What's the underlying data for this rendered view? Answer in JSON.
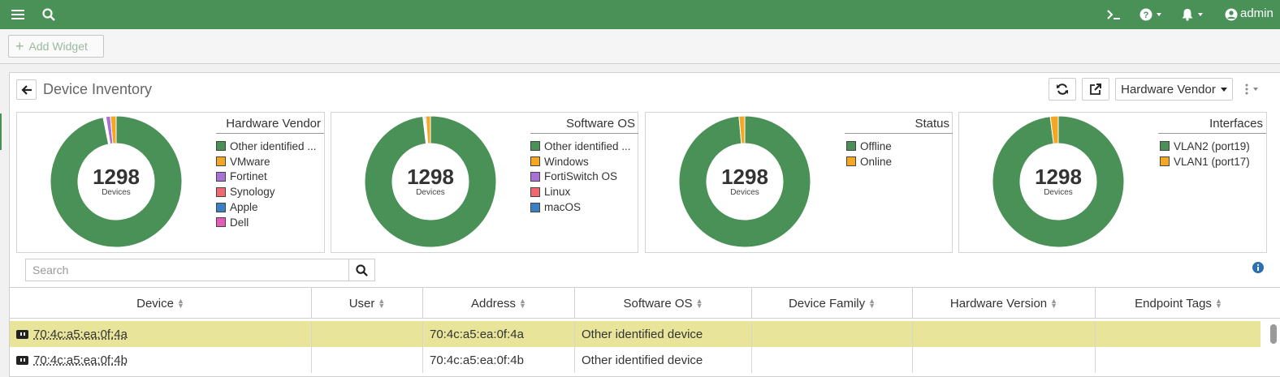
{
  "header": {
    "user": "admin",
    "icons": [
      "menu-icon",
      "search-icon",
      "terminal-icon",
      "help-icon",
      "bell-icon",
      "user-icon"
    ]
  },
  "toolbar": {
    "add_widget_label": "Add Widget"
  },
  "widget": {
    "title": "Device Inventory",
    "dropdown_label": "Hardware Vendor"
  },
  "donuts": [
    {
      "title": "Hardware Vendor",
      "total": "1298",
      "sub": "Devices",
      "legend": [
        {
          "label": "Other identified ...",
          "color": "#4a9158"
        },
        {
          "label": "VMware",
          "color": "#f5a623"
        },
        {
          "label": "Fortinet",
          "color": "#a970d6"
        },
        {
          "label": "Synology",
          "color": "#f0676f"
        },
        {
          "label": "Apple",
          "color": "#3a7fc4"
        },
        {
          "label": "Dell",
          "color": "#e65bb8"
        }
      ]
    },
    {
      "title": "Software OS",
      "total": "1298",
      "sub": "Devices",
      "legend": [
        {
          "label": "Other identified ...",
          "color": "#4a9158"
        },
        {
          "label": "Windows",
          "color": "#f5a623"
        },
        {
          "label": "FortiSwitch OS",
          "color": "#a970d6"
        },
        {
          "label": "Linux",
          "color": "#f0676f"
        },
        {
          "label": "macOS",
          "color": "#3a7fc4"
        }
      ]
    },
    {
      "title": "Status",
      "total": "1298",
      "sub": "Devices",
      "legend": [
        {
          "label": "Offline",
          "color": "#4a9158"
        },
        {
          "label": "Online",
          "color": "#f5a623"
        }
      ]
    },
    {
      "title": "Interfaces",
      "total": "1298",
      "sub": "Devices",
      "legend": [
        {
          "label": "VLAN2 (port19)",
          "color": "#4a9158"
        },
        {
          "label": "VLAN1 (port17)",
          "color": "#f5a623"
        }
      ]
    }
  ],
  "search": {
    "placeholder": "Search"
  },
  "table": {
    "columns": [
      "Device",
      "User",
      "Address",
      "Software OS",
      "Device Family",
      "Hardware Version",
      "Endpoint Tags"
    ],
    "rows": [
      {
        "device": "70:4c:a5:ea:0f:4a",
        "user": "",
        "address": "70:4c:a5:ea:0f:4a",
        "os": "Other identified device",
        "family": "",
        "hw": "",
        "tags": "",
        "selected": true
      },
      {
        "device": "70:4c:a5:ea:0f:4b",
        "user": "",
        "address": "70:4c:a5:ea:0f:4b",
        "os": "Other identified device",
        "family": "",
        "hw": "",
        "tags": "",
        "selected": false
      }
    ]
  }
}
